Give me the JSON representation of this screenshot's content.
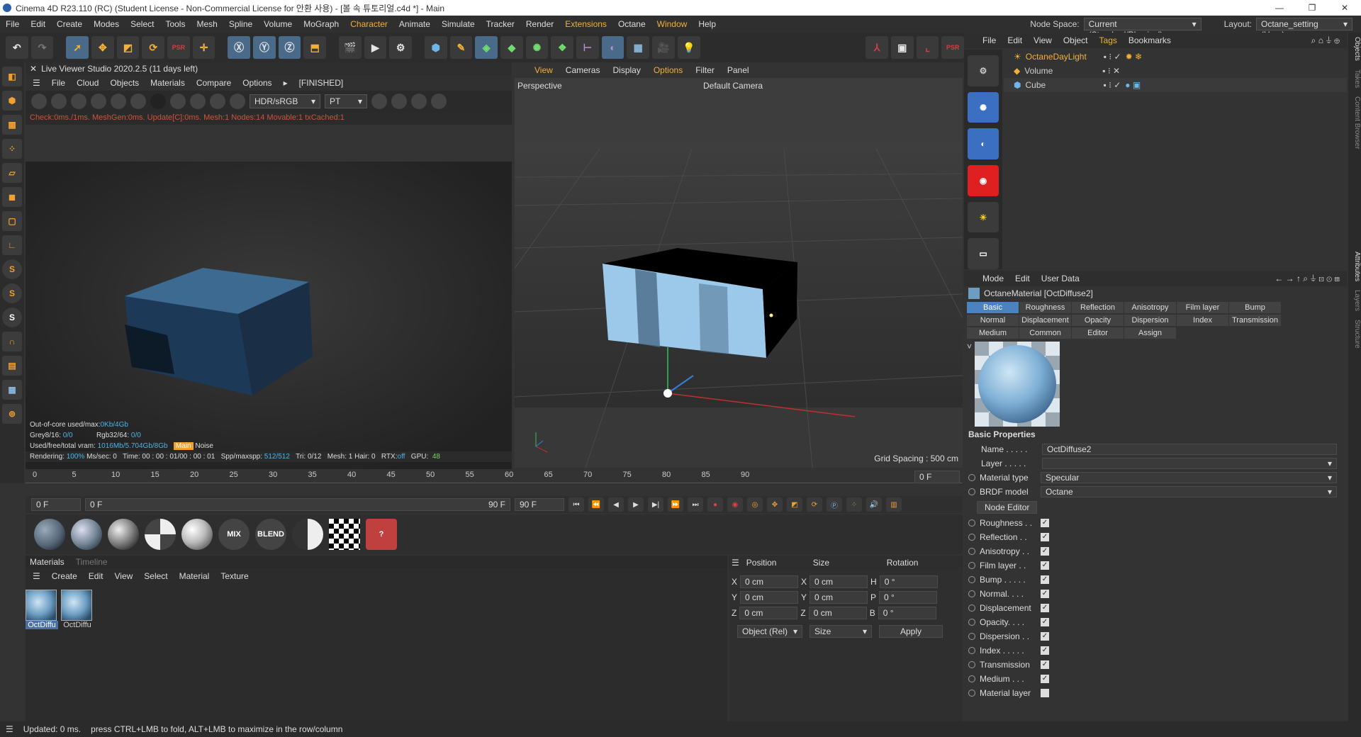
{
  "window": {
    "title": "Cinema 4D R23.110 (RC) (Student License - Non-Commercial License for 안환 사용) - [볼 속 튜토리얼.c4d *] - Main",
    "controls": [
      "—",
      "❐",
      "✕"
    ]
  },
  "menubar": {
    "items": [
      "File",
      "Edit",
      "Create",
      "Modes",
      "Select",
      "Tools",
      "Mesh",
      "Spline",
      "Volume",
      "MoGraph",
      "Character",
      "Animate",
      "Simulate",
      "Tracker",
      "Render",
      "Extensions",
      "Octane",
      "Window",
      "Help"
    ],
    "highlighted": [
      "Character",
      "Extensions",
      "Window"
    ],
    "node_space_label": "Node Space:",
    "node_space_value": "Current (Standard/Physical)",
    "layout_label": "Layout:",
    "layout_value": "Octane_setting (User)"
  },
  "live_viewer": {
    "title": "Live Viewer Studio 2020.2.5 (11 days left)",
    "menu": [
      "File",
      "Cloud",
      "Objects",
      "Materials",
      "Compare",
      "Options"
    ],
    "status_tag": "[FINISHED]",
    "color_space": "HDR/sRGB",
    "kernel": "PT",
    "status_line": "Check:0ms./1ms. MeshGen:0ms. Update[C]:0ms. Mesh:1 Nodes:14 Movable:1 txCached:1",
    "ooc": "Out-of-core used/max:",
    "ooc_val": "0Kb/4Gb",
    "grey_label": "Grey8/16:",
    "grey_val": "0/0",
    "rgb_label": "Rgb32/64:",
    "rgb_val": "0/0",
    "vram_label": "Used/free/total vram:",
    "vram_val": "1016Mb/5.704Gb/8Gb",
    "vram_tag1": "Main",
    "vram_tag2": "Noise",
    "render_line": {
      "rendering": "Rendering:",
      "pct": "100%",
      "ms": "Ms/sec: 0",
      "time": "Time: 00 : 00 : 01/00 : 00 : 01",
      "spp_label": "Spp/maxspp:",
      "spp": "512/512",
      "tri": "Tri: 0/12",
      "mesh": "Mesh: 1  Hair: 0",
      "rtx_label": "RTX:",
      "rtx": "off",
      "gpu_label": "GPU:",
      "gpu": "48"
    }
  },
  "viewport": {
    "menu": [
      "View",
      "Cameras",
      "Display",
      "Options",
      "Filter",
      "Panel"
    ],
    "highlighted": [
      "Options"
    ],
    "name": "Perspective",
    "camera": "Default Camera",
    "grid_spacing": "Grid Spacing : 500 cm"
  },
  "timeline": {
    "ticks": [
      "0",
      "5",
      "10",
      "15",
      "20",
      "25",
      "30",
      "35",
      "40",
      "45",
      "50",
      "55",
      "60",
      "65",
      "70",
      "75",
      "80",
      "85",
      "90"
    ],
    "frame_right": "0 F",
    "start": "0 F",
    "range_start": "0 F",
    "range_end": "90 F",
    "end": "90 F"
  },
  "material_toolbar": {
    "items": [
      "std-diffuse",
      "std-glossy",
      "std-specular",
      "std-checker",
      "std-metal",
      "MIX",
      "BLEND",
      "std-portal",
      "checker-tex",
      "missing"
    ]
  },
  "materials": {
    "tabs": [
      "Materials",
      "Timeline"
    ],
    "menu": [
      "Create",
      "Edit",
      "View",
      "Select",
      "Material",
      "Texture"
    ],
    "items": [
      "OctDiffu",
      "OctDiffu"
    ]
  },
  "coords": {
    "headers": [
      "Position",
      "Size",
      "Rotation"
    ],
    "rows": [
      {
        "a": "X",
        "av": "0 cm",
        "b": "X",
        "bv": "0 cm",
        "c": "H",
        "cv": "0 °"
      },
      {
        "a": "Y",
        "av": "0 cm",
        "b": "Y",
        "bv": "0 cm",
        "c": "P",
        "cv": "0 °"
      },
      {
        "a": "Z",
        "av": "0 cm",
        "b": "Z",
        "bv": "0 cm",
        "c": "B",
        "cv": "0 °"
      }
    ],
    "mode": "Object (Rel)",
    "size_mode": "Size",
    "apply": "Apply"
  },
  "status": {
    "updated": "Updated: 0 ms.",
    "hint": "press CTRL+LMB to fold, ALT+LMB to maximize in the row/column"
  },
  "object_manager": {
    "menu": [
      "File",
      "Edit",
      "View",
      "Object",
      "Tags",
      "Bookmarks"
    ],
    "objects": [
      {
        "name": "OctaneDayLight",
        "color": "#f2b035"
      },
      {
        "name": "Volume",
        "color": "#dddddd"
      },
      {
        "name": "Cube",
        "color": "#dddddd"
      }
    ]
  },
  "side_tabs": [
    "Objects",
    "Takes",
    "Content Browser",
    "Attributes",
    "Layers",
    "Structure"
  ],
  "attributes": {
    "menu": [
      "Mode",
      "Edit",
      "User Data"
    ],
    "title": "OctaneMaterial [OctDiffuse2]",
    "tabs_row1": [
      "Basic",
      "Roughness",
      "Reflection",
      "Anisotropy",
      "Film layer",
      "Bump"
    ],
    "tabs_row2": [
      "Normal",
      "Displacement",
      "Opacity",
      "Dispersion",
      "Index",
      "Transmission"
    ],
    "tabs_row3": [
      "Medium",
      "Common",
      "Editor",
      "Assign"
    ],
    "section": "Basic Properties",
    "name_label": "Name . . . . .",
    "name_val": "OctDiffuse2",
    "layer_label": "Layer . . . . .",
    "mtype_label": "Material type",
    "mtype_val": "Specular",
    "brdf_label": "BRDF model",
    "brdf_val": "Octane",
    "node_editor": "Node Editor",
    "checks": [
      "Roughness . .",
      "Reflection . .",
      "Anisotropy . .",
      "Film layer . .",
      "Bump . . . . .",
      "Normal. . . .",
      "Displacement",
      "Opacity. . . .",
      "Dispersion . .",
      "Index . . . . .",
      "Transmission",
      "Medium . . .",
      "Material layer"
    ]
  }
}
